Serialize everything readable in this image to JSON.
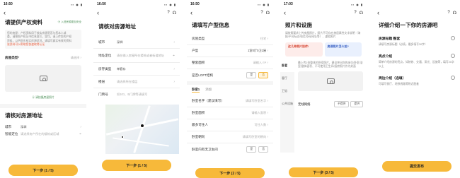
{
  "p1": {
    "status_time": "16:50",
    "title": "请提供产权资料",
    "security_note": "入驻房源更加安全",
    "info_lines": [
      "您的房屋：产权资料用于核实房源是否与您本人或",
      "委，请按照产权证书信息填写，里均，请上传您的产权",
      "资料，以供房东核实房源状况，请填写真实有效的资料",
      "该资料可以帮助您快速取得认证"
    ],
    "deed_type_label": "房屋类型*",
    "deed_type_value": "请选择",
    "upload_hint": "请拍摄房屋照片",
    "section2_title": "请核对房源地址",
    "city_label": "城市",
    "city_value": "深圳",
    "addr_label": "智能定位",
    "addr_value": "请选择房产所在的楼栋或区域",
    "next_button": "下一步 (1 / 5)"
  },
  "p2": {
    "status_time": "16:50",
    "title": "请核对房源地址",
    "rows": [
      {
        "label": "城市",
        "value": "深圳"
      },
      {
        "label": "地址定位",
        "value": "请在输入房屋所在楼栋或者街道地址"
      },
      {
        "label": "房存类型",
        "value": "单套存"
      },
      {
        "label": "楼层",
        "value": "请选择所在楼层"
      },
      {
        "label": "门牌号",
        "value": "如101、B门牌等请填写"
      }
    ],
    "next_button": "下一步 (1 / 5)"
  },
  "p3": {
    "status_time": "16:50",
    "title": "请填写户型信息",
    "rows": [
      {
        "label": "房屋类型",
        "value": "住宅"
      },
      {
        "label": "户型",
        "value": "1室0厅0卫1厨"
      },
      {
        "label": "整套面积",
        "value": "请输入 m²"
      },
      {
        "label": "是否LOFT结构",
        "value": ""
      }
    ],
    "yes": "是",
    "no": "否",
    "room_tab": "卧室1",
    "room_tab2": "添加",
    "rows2": [
      {
        "label": "卧室名字（建议填写）",
        "value": "请填写卧室名字"
      },
      {
        "label": "卧室面积",
        "value": "请输入面积"
      },
      {
        "label": "最多可住人",
        "value": "可住人数"
      },
      {
        "label": "卧室朝向",
        "value": "请填写卧室的朝向"
      },
      {
        "label": "卧室内有无卫生间",
        "value": ""
      }
    ],
    "next_button": "下一步 (2 / 5)"
  },
  "p4": {
    "status_time": "17:03",
    "title": "照片和设施",
    "intro": "请按照要求上传房屋照片，照片不可存在旅居属性文字说明（海报/平台标志/电话号码/网址等）、虚假照片",
    "card1": "这几种照片别传!",
    "card2": "房源照片怎么拍?",
    "side_items": [
      "卧室",
      "客厅",
      "卫浴",
      "公共设施"
    ],
    "photo_note": "最上传1张整体的卧室照片，建议突出你的床位/卧室/浴室/整体面积、不可使用卫生间/厨房照片作为封面",
    "wifi_label": "无线网络",
    "wifi_opt1": "不提供",
    "wifi_opt2": "提供",
    "next_button": "下一步 (3 / 5)"
  },
  "p5": {
    "title": "详细介绍一下你的房源吧",
    "sections": [
      {
        "label": "房源标题 整套",
        "hint": "请填写房源标题（必填，最多填写30字）"
      },
      {
        "label": "亮点介绍",
        "hint": "简单介绍房源的亮点，如装修、交通、采光、设施等，填写20字以上"
      },
      {
        "label": "周边介绍（选填）",
        "hint": "可填写餐厅、地铁线路等附近配套"
      }
    ],
    "submit_button": "提交发布"
  }
}
